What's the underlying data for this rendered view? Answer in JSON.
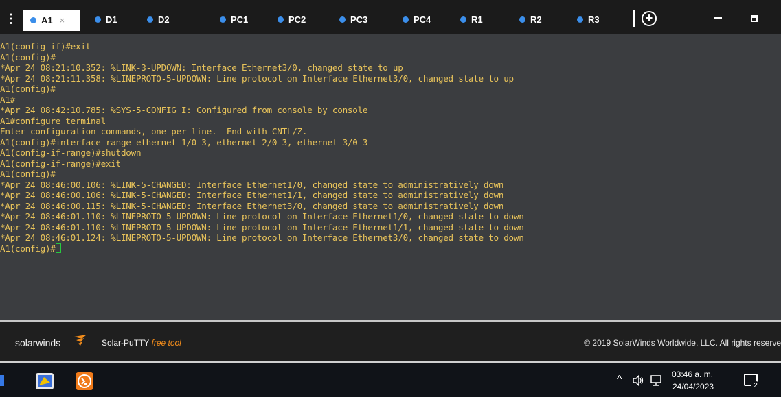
{
  "tabs": [
    {
      "label": "A1",
      "active": true,
      "close": "×"
    },
    {
      "label": "D1"
    },
    {
      "label": "D2"
    },
    {
      "label": "PC1"
    },
    {
      "label": "PC2"
    },
    {
      "label": "PC3"
    },
    {
      "label": "PC4"
    },
    {
      "label": "R1"
    },
    {
      "label": "R2"
    },
    {
      "label": "R3"
    }
  ],
  "toolbar": {
    "menu_icon": "⋮",
    "add_icon": "+"
  },
  "terminal": {
    "lines": [
      "A1(config-if)#exit",
      "A1(config)#",
      "*Apr 24 08:21:10.352: %LINK-3-UPDOWN: Interface Ethernet3/0, changed state to up",
      "*Apr 24 08:21:11.358: %LINEPROTO-5-UPDOWN: Line protocol on Interface Ethernet3/0, changed state to up",
      "A1(config)#",
      "A1#",
      "*Apr 24 08:42:10.785: %SYS-5-CONFIG_I: Configured from console by console",
      "A1#configure terminal",
      "Enter configuration commands, one per line.  End with CNTL/Z.",
      "A1(config)#interface range ethernet 1/0-3, ethernet 2/0-3, ethernet 3/0-3",
      "A1(config-if-range)#shutdown",
      "A1(config-if-range)#exit",
      "A1(config)#",
      "*Apr 24 08:46:00.106: %LINK-5-CHANGED: Interface Ethernet1/0, changed state to administratively down",
      "*Apr 24 08:46:00.106: %LINK-5-CHANGED: Interface Ethernet1/1, changed state to administratively down",
      "*Apr 24 08:46:00.115: %LINK-5-CHANGED: Interface Ethernet3/0, changed state to administratively down",
      "*Apr 24 08:46:01.110: %LINEPROTO-5-UPDOWN: Line protocol on Interface Ethernet1/0, changed state to down",
      "*Apr 24 08:46:01.110: %LINEPROTO-5-UPDOWN: Line protocol on Interface Ethernet1/1, changed state to down",
      "*Apr 24 08:46:01.124: %LINEPROTO-5-UPDOWN: Line protocol on Interface Ethernet3/0, changed state to down"
    ],
    "prompt": "A1(config)#",
    "text_color": "#e8c35a",
    "cursor_color": "#27c93f"
  },
  "footer": {
    "brand": "solarwinds",
    "product": "Solar-PuTTY",
    "free_tool": "free tool",
    "copyright": "© 2019 SolarWinds Worldwide, LLC. All rights reserve"
  },
  "taskbar": {
    "app_icons": [
      "gns3-icon",
      "solar-putty-icon"
    ],
    "tray_chevron": "^",
    "volume_icon": "speaker-icon",
    "network_icon": "network-icon",
    "time": "03:46 a. m.",
    "date": "24/04/2023",
    "notification_count": "2"
  }
}
